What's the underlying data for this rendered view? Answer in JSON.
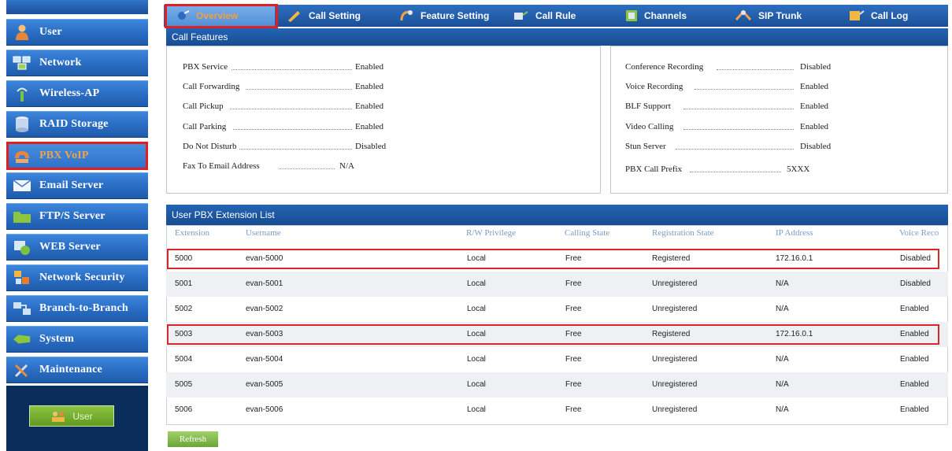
{
  "sidebar": {
    "items": [
      {
        "label": "User",
        "icon": "user-icon"
      },
      {
        "label": "Network",
        "icon": "network-icon"
      },
      {
        "label": "Wireless-AP",
        "icon": "wireless-icon"
      },
      {
        "label": "RAID Storage",
        "icon": "storage-icon"
      },
      {
        "label": "PBX VoIP",
        "icon": "phone-icon"
      },
      {
        "label": "Email Server",
        "icon": "email-icon"
      },
      {
        "label": "FTP/S Server",
        "icon": "folder-icon"
      },
      {
        "label": "WEB Server",
        "icon": "web-icon"
      },
      {
        "label": "Network Security",
        "icon": "security-icon"
      },
      {
        "label": "Branch-to-Branch",
        "icon": "branch-icon"
      },
      {
        "label": "System",
        "icon": "system-icon"
      },
      {
        "label": "Maintenance",
        "icon": "tools-icon"
      }
    ],
    "active": "PBX VoIP",
    "user_button": "User"
  },
  "tabs": [
    {
      "label": "Overview",
      "icon": "overview-icon",
      "active": true
    },
    {
      "label": "Call Setting",
      "icon": "pencil-icon"
    },
    {
      "label": "Feature Setting",
      "icon": "feature-icon"
    },
    {
      "label": "Call Rule",
      "icon": "rule-icon"
    },
    {
      "label": "Channels",
      "icon": "channels-icon"
    },
    {
      "label": "SIP Trunk",
      "icon": "trunk-icon"
    },
    {
      "label": "Call Log",
      "icon": "log-icon"
    }
  ],
  "call_features": {
    "title": "Call Features",
    "left": [
      {
        "label": "PBX Service",
        "value": "Enabled"
      },
      {
        "label": "Call Forwarding",
        "value": "Enabled"
      },
      {
        "label": "Call Pickup",
        "value": "Enabled"
      },
      {
        "label": "Call Parking",
        "value": "Enabled"
      },
      {
        "label": "Do Not Disturb",
        "value": "Disabled"
      },
      {
        "label": "Fax To Email Address",
        "value": "N/A"
      }
    ],
    "right": [
      {
        "label": "Conference Recording",
        "value": "Disabled"
      },
      {
        "label": "Voice Recording",
        "value": "Enabled"
      },
      {
        "label": "BLF Support",
        "value": "Enabled"
      },
      {
        "label": "Video Calling",
        "value": "Enabled"
      },
      {
        "label": "Stun Server",
        "value": "Disabled"
      },
      {
        "label": "PBX Call Prefix",
        "value": "5XXX"
      }
    ]
  },
  "extension_list": {
    "title": "User PBX Extension List",
    "columns": [
      "Extension",
      "Username",
      "R/W Privilege",
      "Calling State",
      "Registration State",
      "IP Address",
      "Voice Reco"
    ],
    "rows": [
      [
        "5000",
        "evan-5000",
        "Local",
        "Free",
        "Registered",
        "172.16.0.1",
        "Disabled"
      ],
      [
        "5001",
        "evan-5001",
        "Local",
        "Free",
        "Unregistered",
        "N/A",
        "Disabled"
      ],
      [
        "5002",
        "evan-5002",
        "Local",
        "Free",
        "Unregistered",
        "N/A",
        "Enabled"
      ],
      [
        "5003",
        "evan-5003",
        "Local",
        "Free",
        "Registered",
        "172.16.0.1",
        "Enabled"
      ],
      [
        "5004",
        "evan-5004",
        "Local",
        "Free",
        "Unregistered",
        "N/A",
        "Enabled"
      ],
      [
        "5005",
        "evan-5005",
        "Local",
        "Free",
        "Unregistered",
        "N/A",
        "Enabled"
      ],
      [
        "5006",
        "evan-5006",
        "Local",
        "Free",
        "Unregistered",
        "N/A",
        "Enabled"
      ]
    ],
    "highlighted_rows": [
      "5000",
      "5003"
    ],
    "refresh_label": "Refresh"
  },
  "colors": {
    "header_blue": "#1b4f97",
    "highlight_red": "#e02020",
    "active_orange": "#f4a040",
    "button_green": "#6aa637"
  }
}
